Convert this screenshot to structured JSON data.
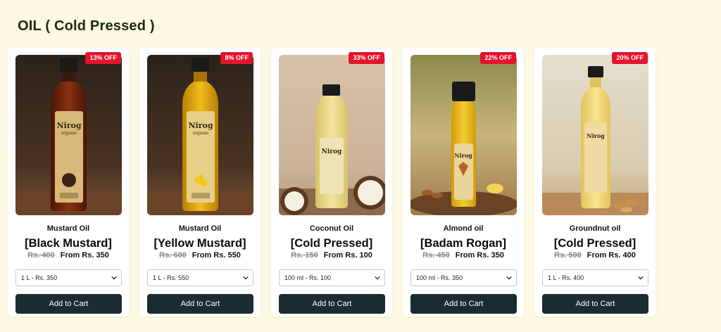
{
  "section": {
    "title": "OIL ( Cold Pressed )"
  },
  "products": [
    {
      "discount": "13% OFF",
      "name": "Mustard Oil",
      "variant": "[Black Mustard]",
      "old_price": "Rs. 400",
      "from_price": "From Rs. 350",
      "selected_option": "1 L - Rs. 350",
      "cta": "Add to Cart",
      "image": "black-mustard-oil-bottle"
    },
    {
      "discount": "8% OFF",
      "name": "Mustard Oil",
      "variant": "[Yellow Mustard]",
      "old_price": "Rs. 600",
      "from_price": "From Rs. 550",
      "selected_option": "1 L - Rs. 550",
      "cta": "Add to Cart",
      "image": "yellow-mustard-oil-bottle"
    },
    {
      "discount": "33% OFF",
      "name": "Coconut Oil",
      "variant": "[Cold Pressed]",
      "old_price": "Rs. 150",
      "from_price": "From Rs. 100",
      "selected_option": "100 ml - Rs. 100",
      "cta": "Add to Cart",
      "image": "coconut-oil-bottle"
    },
    {
      "discount": "22% OFF",
      "name": "Almond oil",
      "variant": "[Badam Rogan]",
      "old_price": "Rs. 450",
      "from_price": "From Rs. 350",
      "selected_option": "100 ml - Rs. 350",
      "cta": "Add to Cart",
      "image": "almond-oil-bottle"
    },
    {
      "discount": "20% OFF",
      "name": "Groundnut oil",
      "variant": "[Cold Pressed]",
      "old_price": "Rs. 500",
      "from_price": "From Rs. 400",
      "selected_option": "1 L - Rs. 400",
      "cta": "Add to Cart",
      "image": "groundnut-oil-bottle"
    }
  ],
  "colors": {
    "background": "#fdf8e1",
    "badge": "#e3152c",
    "button": "#1b2c30"
  }
}
